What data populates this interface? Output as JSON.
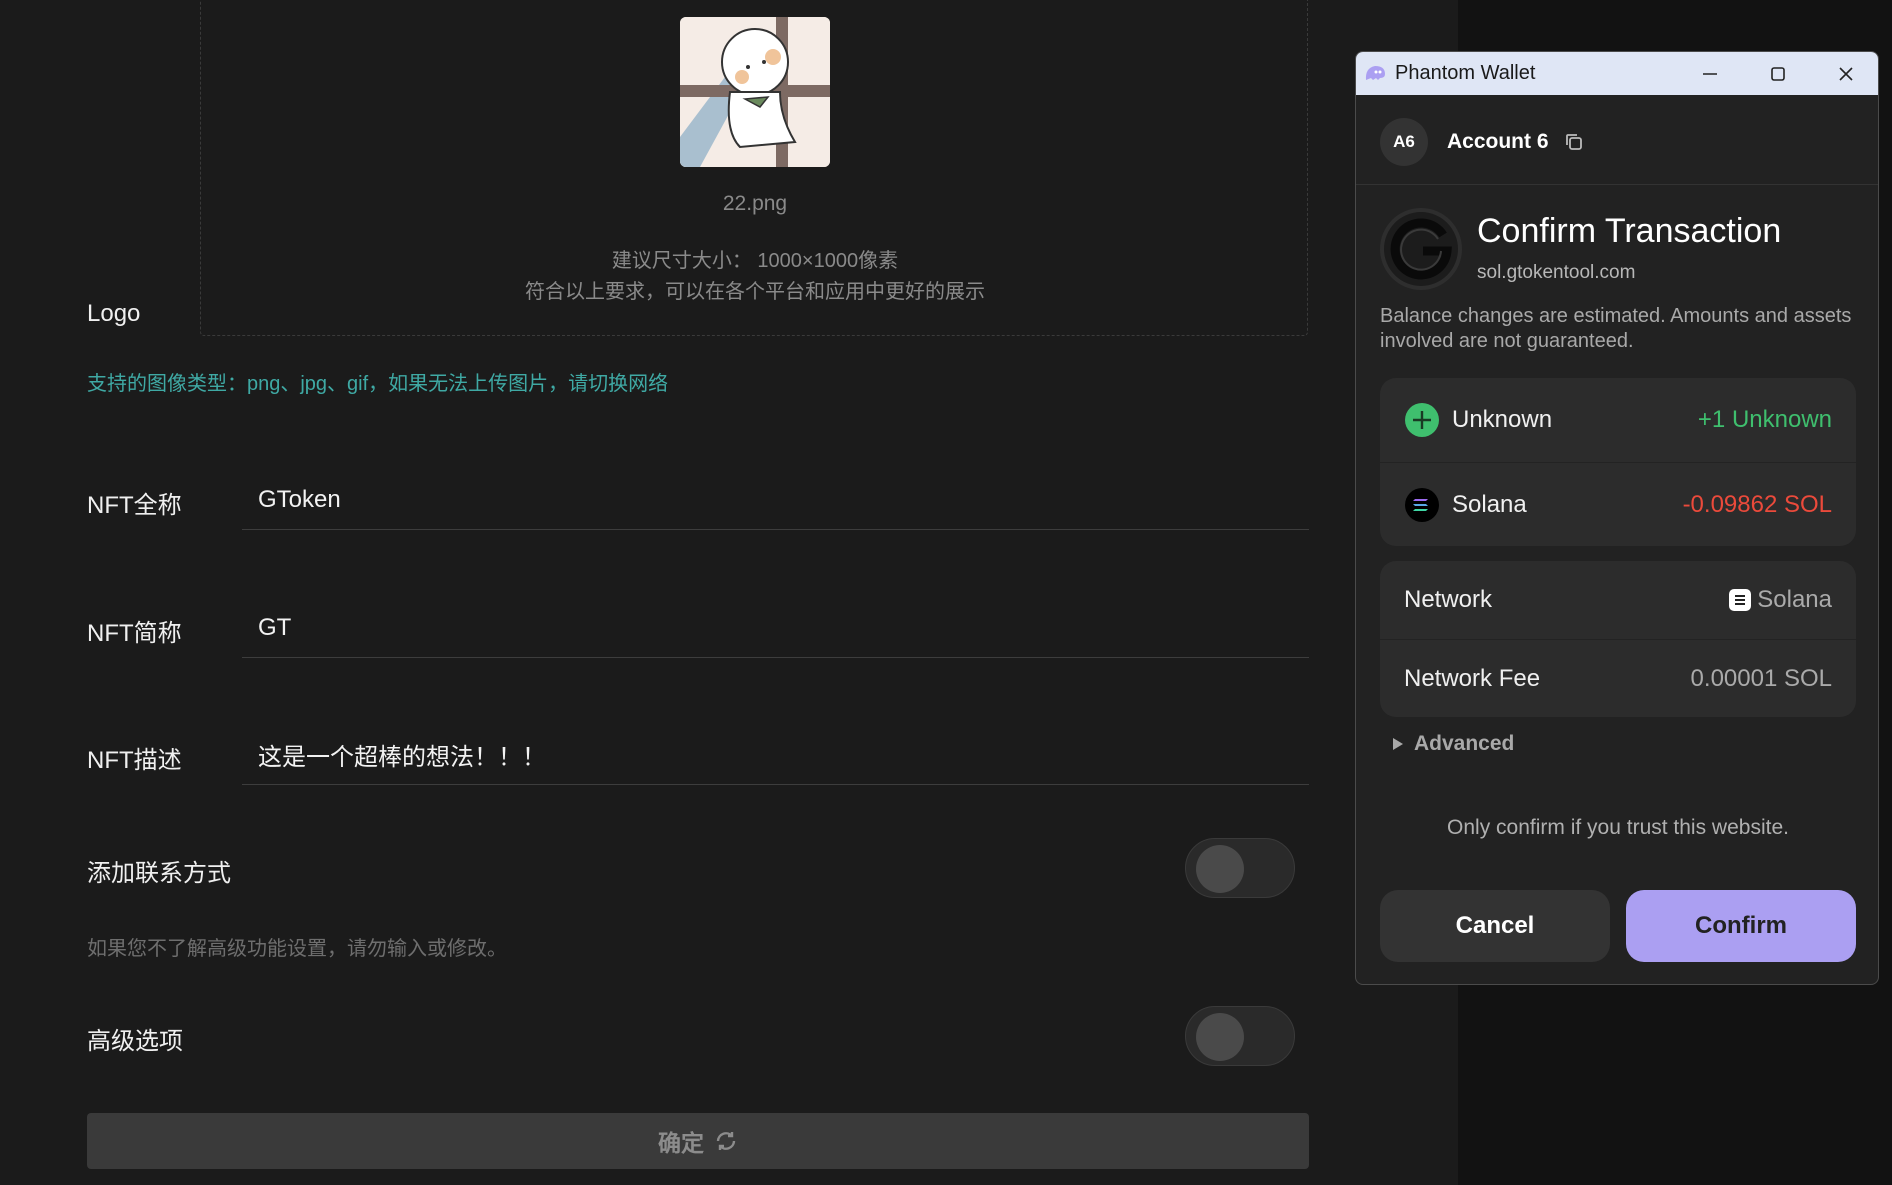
{
  "form": {
    "file_name": "22.png",
    "size_hint": "建议尺寸大小： 1000×1000像素",
    "platform_hint": "符合以上要求，可以在各个平台和应用中更好的展示",
    "logo_label": "Logo",
    "support_text": "支持的图像类型：png、jpg、gif，如果无法上传图片，请切换网络",
    "fields": [
      {
        "label": "NFT全称",
        "value": "GToken"
      },
      {
        "label": "NFT简称",
        "value": "GT"
      },
      {
        "label": "NFT描述",
        "value": "这是一个超棒的想法！！！"
      }
    ],
    "contact_label": "添加联系方式",
    "contact_toggle_on": false,
    "advanced_hint": "如果您不了解高级功能设置，请勿输入或修改。",
    "advanced_label": "高级选项",
    "advanced_toggle_on": false,
    "submit_label": "确定"
  },
  "wallet": {
    "window_title": "Phantom Wallet",
    "account_avatar": "A6",
    "account_name": "Account 6",
    "title": "Confirm Transaction",
    "site": "sol.gtokentool.com",
    "warning": "Balance changes are estimated. Amounts and assets involved are not guaranteed.",
    "changes": [
      {
        "name": "Unknown",
        "amount": "+1 Unknown",
        "color": "#3fbf6e",
        "icon": "plus-icon"
      },
      {
        "name": "Solana",
        "amount": "-0.09862 SOL",
        "color": "#eb4a3b",
        "icon": "solana-icon"
      }
    ],
    "network_label": "Network",
    "network_value": "Solana",
    "fee_label": "Network Fee",
    "fee_value": "0.00001 SOL",
    "advanced": "Advanced",
    "trust": "Only confirm if you trust this website.",
    "cancel": "Cancel",
    "confirm": "Confirm",
    "accent": "#ab9ff2"
  }
}
